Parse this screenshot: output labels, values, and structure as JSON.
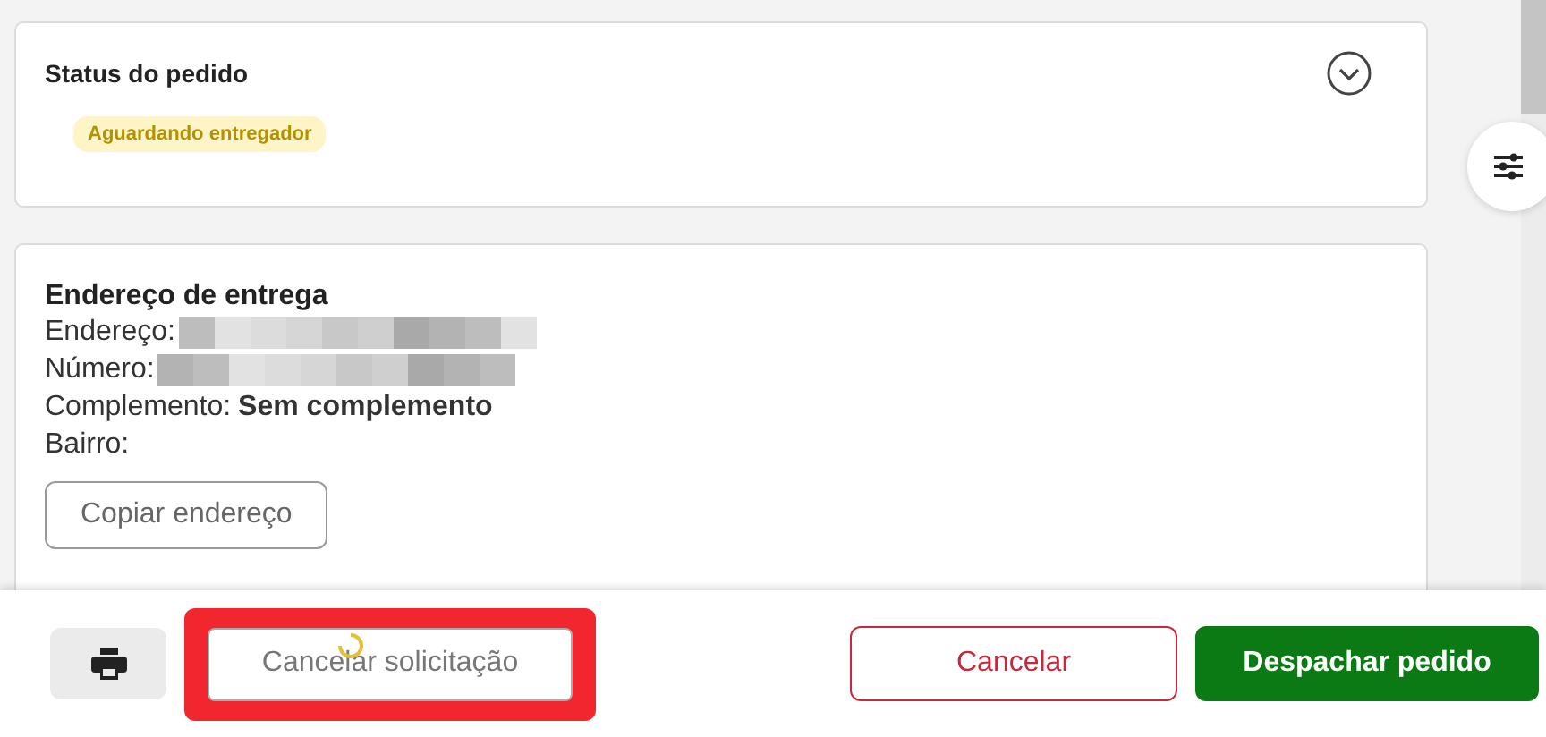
{
  "status_card": {
    "title": "Status do pedido",
    "badge": "Aguardando entregador",
    "expanded": false
  },
  "address_card": {
    "title": "Endereço de entrega",
    "fields": [
      {
        "label": "Endereço:",
        "redacted": true
      },
      {
        "label": "Número:",
        "redacted": true
      },
      {
        "label": "Complemento:",
        "value": "Sem complemento",
        "redacted": false
      },
      {
        "label": "Bairro:",
        "redacted": false
      }
    ],
    "copy_button": "Copiar endereço"
  },
  "footer": {
    "buttons": [
      {
        "kind": "print"
      },
      {
        "kind": "outline",
        "label": "Cancelar solicitação",
        "highlighted": true,
        "loading": true
      },
      {
        "kind": "danger",
        "label": "Cancelar"
      },
      {
        "kind": "primary",
        "label": "Despachar pedido"
      }
    ]
  }
}
